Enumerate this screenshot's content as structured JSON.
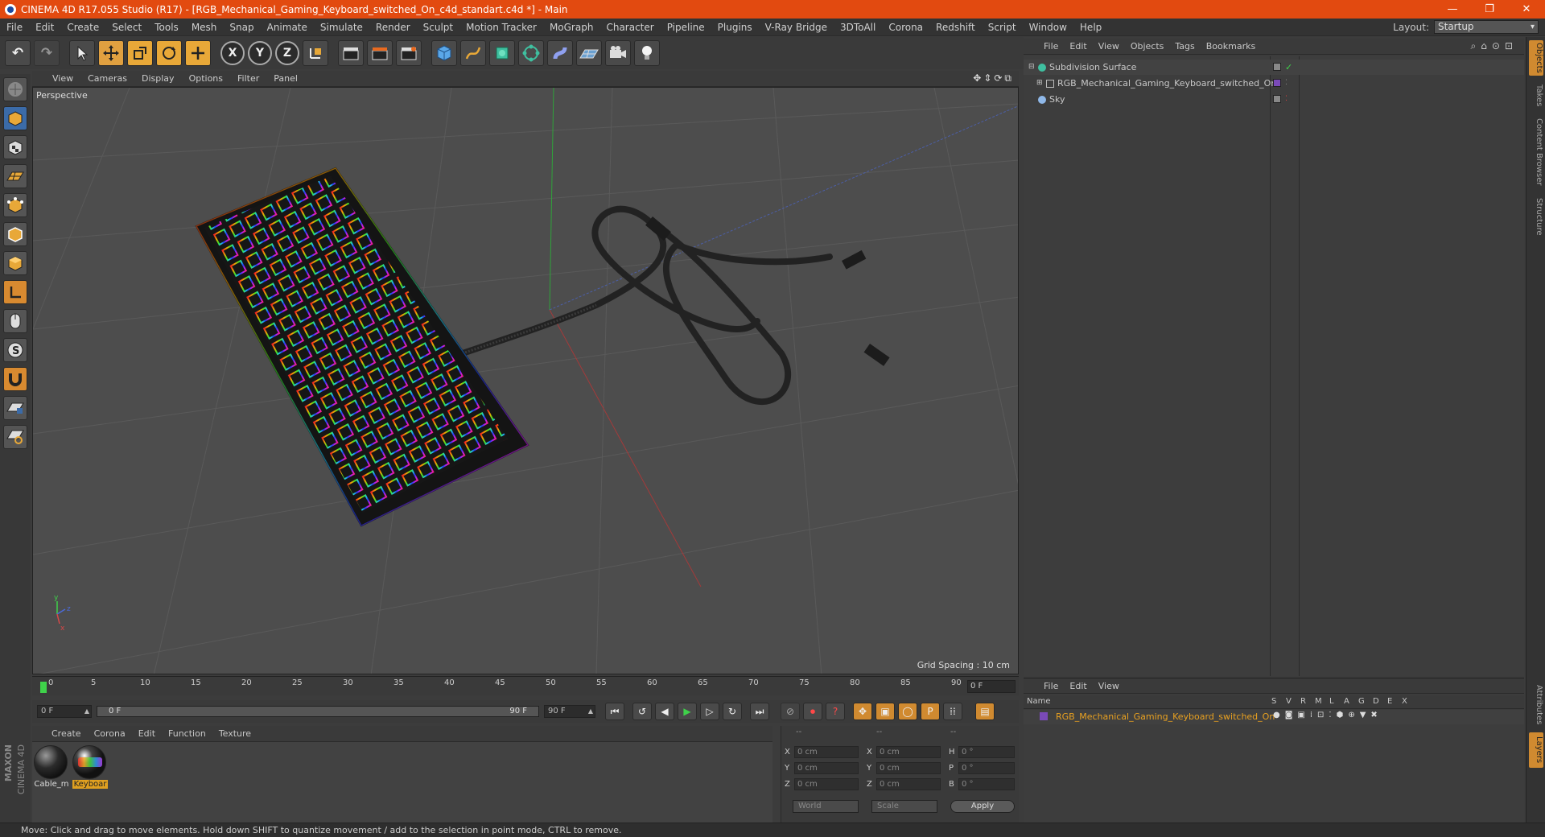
{
  "window": {
    "title": "CINEMA 4D R17.055 Studio (R17) - [RGB_Mechanical_Gaming_Keyboard_switched_On_c4d_standart.c4d *] - Main",
    "minimize": "—",
    "restore": "❐",
    "close": "✕"
  },
  "menubar": {
    "items": [
      "File",
      "Edit",
      "Create",
      "Select",
      "Tools",
      "Mesh",
      "Snap",
      "Animate",
      "Simulate",
      "Render",
      "Sculpt",
      "Motion Tracker",
      "MoGraph",
      "Character",
      "Pipeline",
      "Plugins",
      "V-Ray Bridge",
      "3DToAll",
      "Corona",
      "Redshift",
      "Script",
      "Window",
      "Help"
    ],
    "layout_label": "Layout:",
    "layout_value": "Startup"
  },
  "toolbar": {
    "undo": "↶",
    "redo": "↷",
    "axis_x": "X",
    "axis_y": "Y",
    "axis_z": "Z"
  },
  "viewport": {
    "menu": [
      "View",
      "Cameras",
      "Display",
      "Options",
      "Filter",
      "Panel"
    ],
    "nav_icons": "✥⇕⟳⧉",
    "label": "Perspective",
    "grid_spacing": "Grid Spacing : 10 cm",
    "axis_y": "y",
    "axis_z": "z",
    "axis_x": "x"
  },
  "timeline": {
    "ticks": [
      "0",
      "5",
      "10",
      "15",
      "20",
      "25",
      "30",
      "35",
      "40",
      "45",
      "50",
      "55",
      "60",
      "65",
      "70",
      "75",
      "80",
      "85",
      "90"
    ],
    "current_frame": "0 F"
  },
  "playback": {
    "start_field": "0 F",
    "range_start": "0 F",
    "range_end": "90 F",
    "end_field": "90 F"
  },
  "materials": {
    "menu": [
      "Create",
      "Corona",
      "Edit",
      "Function",
      "Texture"
    ],
    "items": [
      {
        "label": "Cable_m"
      },
      {
        "label": "Keyboar"
      }
    ]
  },
  "coordinates": {
    "header": [
      "--",
      "--",
      "--"
    ],
    "rows": [
      {
        "a": "X",
        "av": "0 cm",
        "b": "X",
        "bv": "0 cm",
        "c": "H",
        "cv": "0 °"
      },
      {
        "a": "Y",
        "av": "0 cm",
        "b": "Y",
        "bv": "0 cm",
        "c": "P",
        "cv": "0 °"
      },
      {
        "a": "Z",
        "av": "0 cm",
        "b": "Z",
        "bv": "0 cm",
        "c": "B",
        "cv": "0 °"
      }
    ],
    "mode": "World",
    "size": "Scale",
    "apply": "Apply"
  },
  "objects": {
    "menu": [
      "File",
      "Edit",
      "View",
      "Objects",
      "Tags",
      "Bookmarks"
    ],
    "tree": [
      {
        "name": "Subdivision Surface",
        "color": "#3fc0a0"
      },
      {
        "name": "RGB_Mechanical_Gaming_Keyboard_switched_On",
        "color": "#a0a0a0"
      },
      {
        "name": "Sky",
        "color": "#8fb8e8"
      }
    ]
  },
  "layers": {
    "menu": [
      "File",
      "Edit",
      "View"
    ],
    "headers": {
      "name": "Name",
      "s": "S",
      "v": "V",
      "r": "R",
      "m": "M",
      "l": "L",
      "a": "A",
      "g": "G",
      "d": "D",
      "e": "E",
      "x": "X"
    },
    "row": "RGB_Mechanical_Gaming_Keyboard_switched_On"
  },
  "right_tabs": [
    "Objects",
    "Takes",
    "Content Browser",
    "Structure",
    "Attributes",
    "Layers"
  ],
  "status": "Move: Click and drag to move elements. Hold down SHIFT to quantize movement / add to the selection in point mode, CTRL to remove.",
  "brand": {
    "maxon": "MAXON",
    "c4d": "CINEMA 4D"
  },
  "colors": {
    "title_bar": "#e24a10",
    "accent": "#e0a040"
  }
}
